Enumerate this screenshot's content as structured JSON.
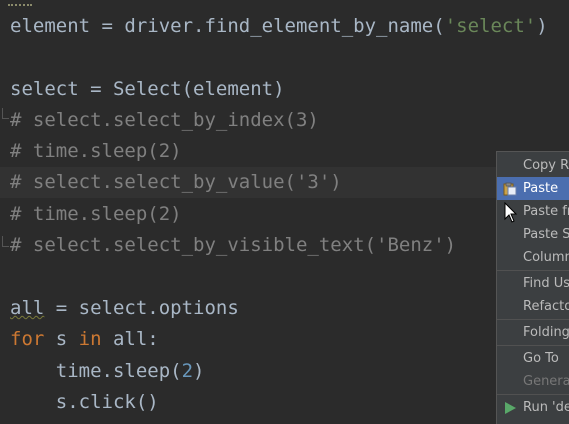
{
  "code": {
    "line1": {
      "a": "element = driver.find_element_by_name(",
      "s": "'select'",
      "b": ")"
    },
    "line2": {
      "a": "select = Select(element)"
    },
    "line3": {
      "c": "# select.select_by_index(3)"
    },
    "line4": {
      "c": "# time.sleep(2)"
    },
    "line5": {
      "c": "# select.select_by_value('3')"
    },
    "line6": {
      "c": "# time.sleep(2)"
    },
    "line7": {
      "c": "# select.select_by_visible_text('Benz')"
    },
    "line8": {
      "a": "all",
      "b": " = select.options"
    },
    "line9": {
      "k1": "for",
      "a": " s ",
      "k2": "in",
      "b": " all:"
    },
    "line10": {
      "a": "    time.sleep(",
      "n": "2",
      "b": ")"
    },
    "line11": {
      "a": "    s.click()"
    }
  },
  "context_menu": {
    "items": [
      {
        "label": "Copy Re"
      },
      {
        "label": "Paste",
        "icon": "paste-icon",
        "selected": true
      },
      {
        "label": "Paste fr"
      },
      {
        "label": "Paste Si"
      },
      {
        "label": "Column"
      },
      {
        "label": "Find Usa"
      },
      {
        "label": "Refactor"
      },
      {
        "label": "Folding"
      },
      {
        "label": "Go To"
      },
      {
        "label": "Generat",
        "disabled": true
      },
      {
        "label": "Run 'de",
        "icon": "run-icon"
      }
    ]
  }
}
